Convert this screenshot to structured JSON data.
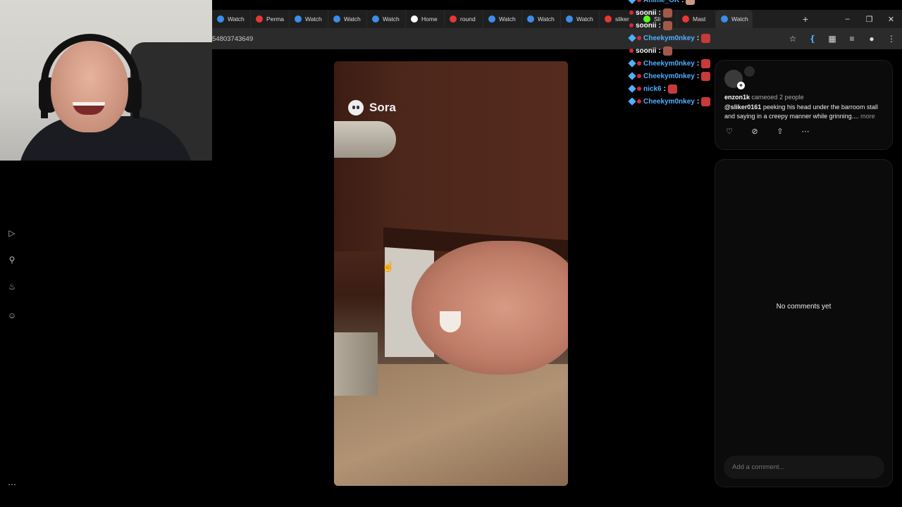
{
  "browser": {
    "tabs": [
      {
        "label": "Watch",
        "favicon": "sora-icon"
      },
      {
        "label": "Perma",
        "favicon": "youtube-icon"
      },
      {
        "label": "Watch",
        "favicon": "sora-icon"
      },
      {
        "label": "Watch",
        "favicon": "sora-icon"
      },
      {
        "label": "Watch",
        "favicon": "sora-icon"
      },
      {
        "label": "Home",
        "favicon": "x-icon"
      },
      {
        "label": "round",
        "favicon": "youtube-icon"
      },
      {
        "label": "Watch",
        "favicon": "sora-icon"
      },
      {
        "label": "Watch",
        "favicon": "sora-icon"
      },
      {
        "label": "Watch",
        "favicon": "sora-icon"
      },
      {
        "label": "sliker",
        "favicon": "youtube-icon"
      },
      {
        "label": "Sli",
        "favicon": "kick-icon"
      },
      {
        "label": "Mast",
        "favicon": "youtube-icon"
      },
      {
        "label": "Watch",
        "favicon": "sora-icon"
      }
    ],
    "url_fragment": "54803743649"
  },
  "chat": [
    {
      "user": "Anime_OK",
      "color": "#4fb0ff",
      "emote": "tan"
    },
    {
      "user": "soonii",
      "color": "#ffffff",
      "emote": "tan2"
    },
    {
      "user": "soonii",
      "color": "#ffffff",
      "emote": "tan2"
    },
    {
      "user": "Cheekym0nkey",
      "color": "#4fb0ff",
      "emote": "red"
    },
    {
      "user": "soonii",
      "color": "#ffffff",
      "emote": "tan2"
    },
    {
      "user": "Cheekym0nkey",
      "color": "#4fb0ff",
      "emote": "red"
    },
    {
      "user": "Cheekym0nkey",
      "color": "#4fb0ff",
      "emote": "red"
    },
    {
      "user": "nick6",
      "color": "#4fb0ff",
      "emote": "red"
    },
    {
      "user": "Cheekym0nkey",
      "color": "#4fb0ff",
      "emote": "red"
    }
  ],
  "video": {
    "watermark": "Sora"
  },
  "post": {
    "author": "enzon1k",
    "meta": "cameoed 2 people",
    "mention": "@sliker0161",
    "description": " peeking his head under the barroom stall and saying in a creepy manner while grinning....",
    "more_label": "more"
  },
  "comments": {
    "empty_text": "No comments yet",
    "input_placeholder": "Add a comment..."
  },
  "colors": {
    "accent_blue": "#4fb0ff",
    "background": "#000000",
    "panel": "#0b0b0b"
  }
}
